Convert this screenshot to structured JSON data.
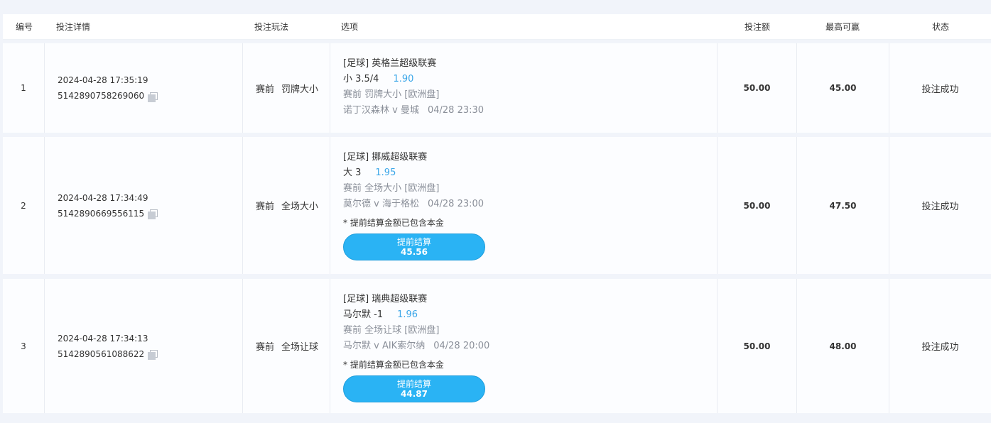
{
  "headers": {
    "no": "编号",
    "detail": "投注详情",
    "play": "投注玩法",
    "option": "选项",
    "amount": "投注额",
    "max_win": "最高可赢",
    "status": "状态"
  },
  "rows": [
    {
      "no": "1",
      "time": "2024-04-28 17:35:19",
      "id": "5142890758269060",
      "play_stage": "赛前",
      "play_type": "罚牌大小",
      "league": "[足球] 英格兰超级联赛",
      "selection": "小 3.5/4",
      "odds": "1.90",
      "market_stage": "赛前",
      "market": "罚牌大小 [欧洲盘]",
      "match": "诺丁汉森林 v 曼城",
      "match_time": "04/28 23:30",
      "amount": "50.00",
      "max_win": "45.00",
      "status": "投注成功"
    },
    {
      "no": "2",
      "time": "2024-04-28 17:34:49",
      "id": "5142890669556115",
      "play_stage": "赛前",
      "play_type": "全场大小",
      "league": "[足球] 挪威超级联赛",
      "selection": "大 3",
      "odds": "1.95",
      "market_stage": "赛前",
      "market": "全场大小 [欧洲盘]",
      "match": "莫尔德 v 海于格松",
      "match_time": "04/28 23:00",
      "note": "* 提前结算金额已包含本金",
      "cashout_label": "提前结算",
      "cashout_amount": "45.56",
      "amount": "50.00",
      "max_win": "47.50",
      "status": "投注成功"
    },
    {
      "no": "3",
      "time": "2024-04-28 17:34:13",
      "id": "5142890561088622",
      "play_stage": "赛前",
      "play_type": "全场让球",
      "league": "[足球] 瑞典超级联赛",
      "selection": "马尔默 -1",
      "odds": "1.96",
      "market_stage": "赛前",
      "market": "全场让球 [欧洲盘]",
      "match": "马尔默 v AIK索尔纳",
      "match_time": "04/28 20:00",
      "note": "* 提前结算金额已包含本金",
      "cashout_label": "提前结算",
      "cashout_amount": "44.87",
      "amount": "50.00",
      "max_win": "48.00",
      "status": "投注成功"
    }
  ],
  "icons": {
    "copy": "copy-icon"
  },
  "colors": {
    "accent": "#2ab3f4",
    "odds": "#3aa6e8",
    "muted": "#8a8f99"
  }
}
